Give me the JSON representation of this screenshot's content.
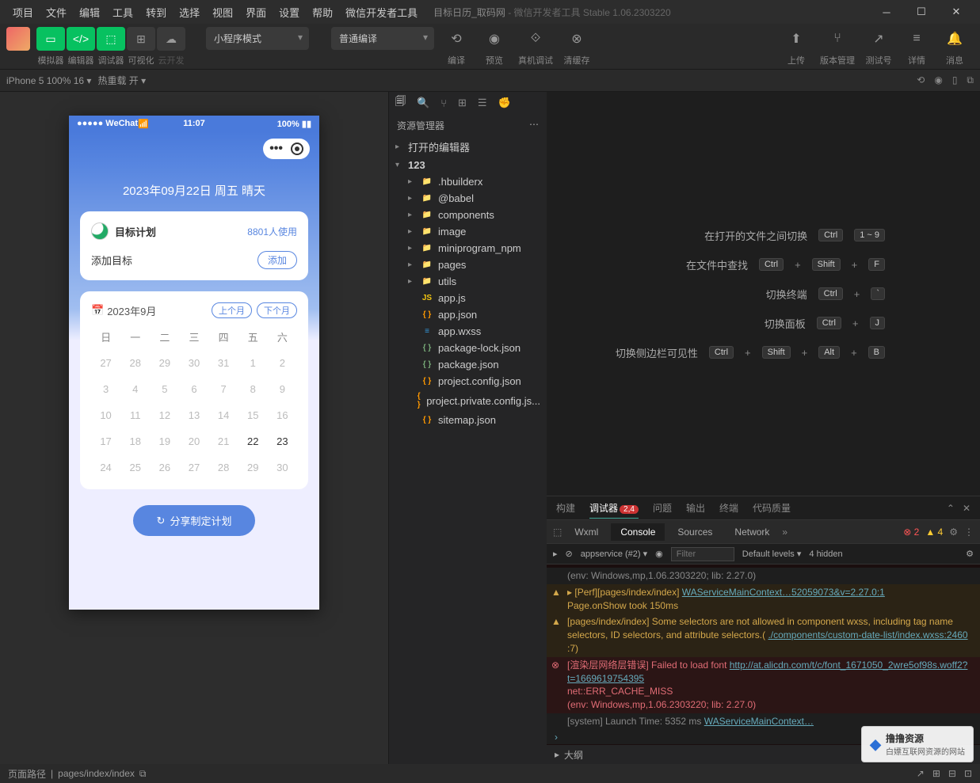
{
  "menubar": [
    "项目",
    "文件",
    "编辑",
    "工具",
    "转到",
    "选择",
    "视图",
    "界面",
    "设置",
    "帮助",
    "微信开发者工具"
  ],
  "title": {
    "project": "目标日历_取码网",
    "suffix": " - 微信开发者工具 Stable 1.06.2303220"
  },
  "toolbar": {
    "groups": [
      "模拟器",
      "编辑器",
      "调试器",
      "可视化",
      "云开发"
    ],
    "mode_select": "小程序模式",
    "compile_select": "普通编译",
    "actions": {
      "compile": "编译",
      "preview": "预览",
      "remote": "真机调试",
      "clear": "清缓存",
      "upload": "上传",
      "version": "版本管理",
      "test": "测试号",
      "detail": "详情",
      "message": "消息"
    }
  },
  "devicebar": {
    "device": "iPhone 5 100% 16",
    "hotreload": "热重载 开"
  },
  "phone": {
    "status": {
      "carrier": "●●●●● WeChat",
      "time": "11:07",
      "battery": "100%"
    },
    "date_line": "2023年09月22日 周五 晴天",
    "plan_card": {
      "title": "目标计划",
      "users": "8801人使用",
      "add_label": "添加目标",
      "add_btn": "添加"
    },
    "calendar": {
      "month": "2023年9月",
      "prev": "上个月",
      "next": "下个月",
      "dow": [
        "日",
        "一",
        "二",
        "三",
        "四",
        "五",
        "六"
      ],
      "days": [
        {
          "n": "27"
        },
        {
          "n": "28"
        },
        {
          "n": "29"
        },
        {
          "n": "30"
        },
        {
          "n": "31"
        },
        {
          "n": "1"
        },
        {
          "n": "2"
        },
        {
          "n": "3"
        },
        {
          "n": "4"
        },
        {
          "n": "5"
        },
        {
          "n": "6"
        },
        {
          "n": "7"
        },
        {
          "n": "8"
        },
        {
          "n": "9"
        },
        {
          "n": "10"
        },
        {
          "n": "11"
        },
        {
          "n": "12"
        },
        {
          "n": "13"
        },
        {
          "n": "14"
        },
        {
          "n": "15"
        },
        {
          "n": "16"
        },
        {
          "n": "17"
        },
        {
          "n": "18"
        },
        {
          "n": "19"
        },
        {
          "n": "20"
        },
        {
          "n": "21"
        },
        {
          "n": "22",
          "cur": true
        },
        {
          "n": "23",
          "cur": true
        },
        {
          "n": "24"
        },
        {
          "n": "25"
        },
        {
          "n": "26"
        },
        {
          "n": "27"
        },
        {
          "n": "28"
        },
        {
          "n": "29"
        },
        {
          "n": "30"
        }
      ]
    },
    "share_btn": "分享制定计划"
  },
  "explorer": {
    "title": "资源管理器",
    "open_editors": "打开的编辑器",
    "root": "123",
    "tree": [
      {
        "name": ".hbuilderx",
        "type": "folder"
      },
      {
        "name": "@babel",
        "type": "folder"
      },
      {
        "name": "components",
        "type": "folder-g"
      },
      {
        "name": "image",
        "type": "folder"
      },
      {
        "name": "miniprogram_npm",
        "type": "folder"
      },
      {
        "name": "pages",
        "type": "folder-r"
      },
      {
        "name": "utils",
        "type": "folder-g"
      },
      {
        "name": "app.js",
        "type": "js"
      },
      {
        "name": "app.json",
        "type": "json"
      },
      {
        "name": "app.wxss",
        "type": "css"
      },
      {
        "name": "package-lock.json",
        "type": "json-g"
      },
      {
        "name": "package.json",
        "type": "json-g"
      },
      {
        "name": "project.config.json",
        "type": "json"
      },
      {
        "name": "project.private.config.js...",
        "type": "json"
      },
      {
        "name": "sitemap.json",
        "type": "json"
      }
    ]
  },
  "shortcuts": [
    {
      "label": "在打开的文件之间切换",
      "keys": [
        "Ctrl",
        "1 ~ 9"
      ]
    },
    {
      "label": "在文件中查找",
      "keys": [
        "Ctrl",
        "+",
        "Shift",
        "+",
        "F"
      ]
    },
    {
      "label": "切换终端",
      "keys": [
        "Ctrl",
        "+",
        "`"
      ]
    },
    {
      "label": "切换面板",
      "keys": [
        "Ctrl",
        "+",
        "J"
      ]
    },
    {
      "label": "切换侧边栏可见性",
      "keys": [
        "Ctrl",
        "+",
        "Shift",
        "+",
        "Alt",
        "+",
        "B"
      ]
    }
  ],
  "panel": {
    "tabs": [
      "构建",
      "调试器",
      "问题",
      "输出",
      "终端",
      "代码质量"
    ],
    "badge": "2,4",
    "devtools": [
      "Wxml",
      "Console",
      "Sources",
      "Network"
    ],
    "errors": "2",
    "warnings": "4",
    "context": "appservice (#2)",
    "filter_ph": "Filter",
    "levels": "Default levels",
    "hidden": "4 hidden",
    "logs": [
      {
        "type": "info",
        "text": "(env: Windows,mp,1.06.2303220; lib: 2.27.0)"
      },
      {
        "type": "warn",
        "text": "▸ [Perf][pages/index/index]",
        "link": "WAServiceMainContext…52059073&v=2.27.0:1",
        "text2": "Page.onShow took 150ms"
      },
      {
        "type": "warn",
        "text": "[pages/index/index] Some selectors are not allowed in component wxss, including tag name selectors, ID selectors, and attribute selectors.(",
        "link": "./components/custom-date-list/index.wxss:2460",
        "text2": ":7)"
      },
      {
        "type": "err",
        "text": "[渲染层网络层错误] Failed to load font ",
        "link": "http://at.alicdn.com/t/c/font_1671050_2wre5of98s.woff2?t=1669619754395",
        "text2": "net::ERR_CACHE_MISS",
        "text3": "(env: Windows,mp,1.06.2303220; lib: 2.27.0)"
      },
      {
        "type": "info2",
        "text": "[system] Launch Time: 5352 ms",
        "link": "WAServiceMainContext…"
      }
    ]
  },
  "outline": "大纲",
  "statusbar": {
    "path_label": "页面路径",
    "path": "pages/index/index"
  },
  "watermark": {
    "title": "撸撸资源",
    "sub": "白嫖互联网资源的网站"
  }
}
